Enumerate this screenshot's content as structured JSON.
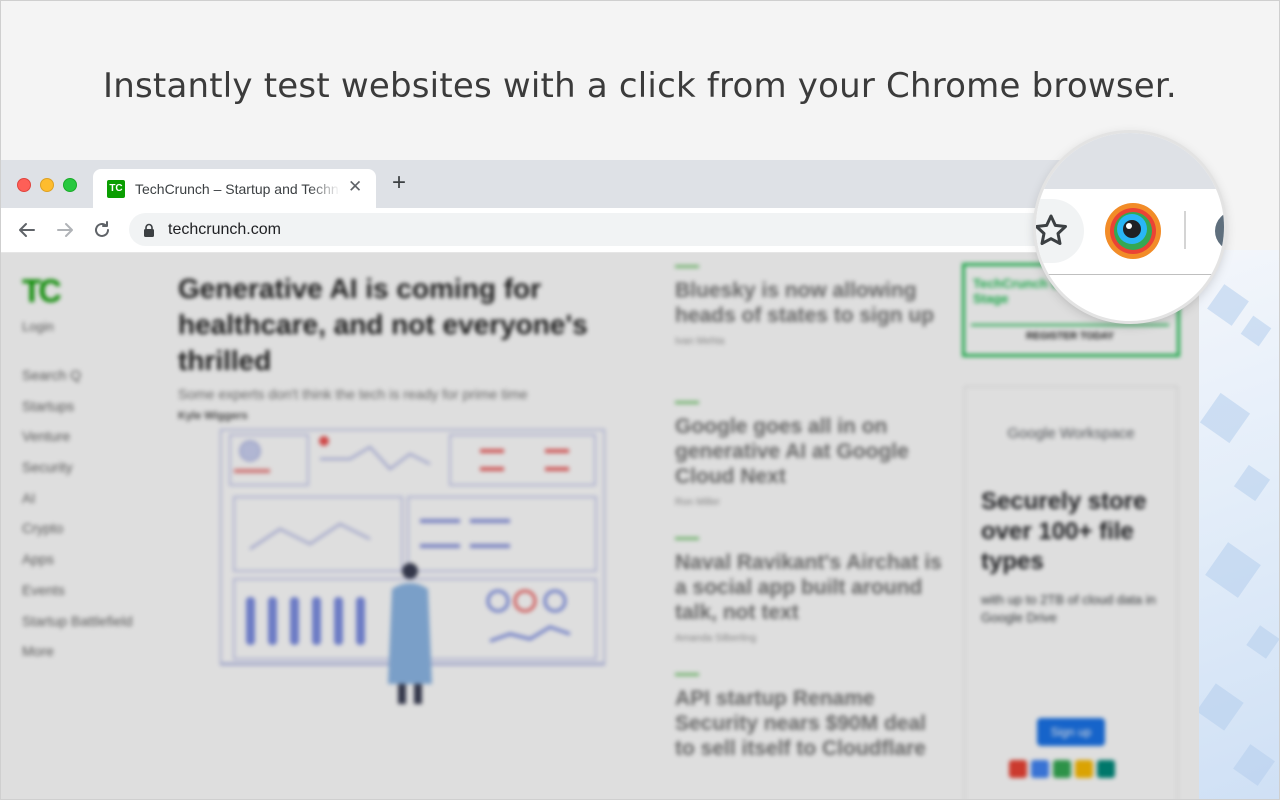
{
  "headline": "Instantly test websites with a click from your Chrome browser.",
  "browser": {
    "tab": {
      "title": "TechCrunch – Startup and Technology News",
      "favicon": "TC"
    },
    "new_tab_symbol": "+",
    "url": "techcrunch.com"
  },
  "page": {
    "logo": "TC",
    "login": "Login",
    "sidebar": [
      "Search Q",
      "Startups",
      "Venture",
      "Security",
      "AI",
      "Crypto",
      "Apps",
      "Events",
      "Startup Battlefield",
      "More"
    ],
    "main_article": {
      "title": "Generative AI is coming for healthcare, and not everyone's thrilled",
      "subtitle": "Some experts don't think the tech is ready for prime time",
      "author": "Kyle Wiggers"
    },
    "news": [
      {
        "title": "Bluesky is now allowing heads of states to sign up",
        "author": "Ivan Mehta"
      },
      {
        "title": "Google goes all in on generative AI at Google Cloud Next",
        "author": "Ron Miller"
      },
      {
        "title": "Naval Ravikant's Airchat is a social app built around talk, not text",
        "author": "Amanda Silberling"
      },
      {
        "title": "API startup Rename Security nears $90M deal to sell itself to Cloudflare",
        "author": ""
      }
    ],
    "promo": {
      "title": "TechCrunch Early Stage",
      "button": "REGISTER TODAY"
    },
    "ad": {
      "brand": "Google Workspace",
      "headline": "Securely store over 100+ file types",
      "sub": "with up to 2TB of cloud data in Google Drive",
      "button": "Sign up"
    }
  },
  "colors": {
    "tc_green": "#0a9e01",
    "extension_ring": "#f28c28",
    "google_blue": "#1a73e8"
  },
  "icons": [
    "back-arrow-icon",
    "forward-arrow-icon",
    "reload-icon",
    "lock-icon",
    "star-icon",
    "extension-icon"
  ]
}
